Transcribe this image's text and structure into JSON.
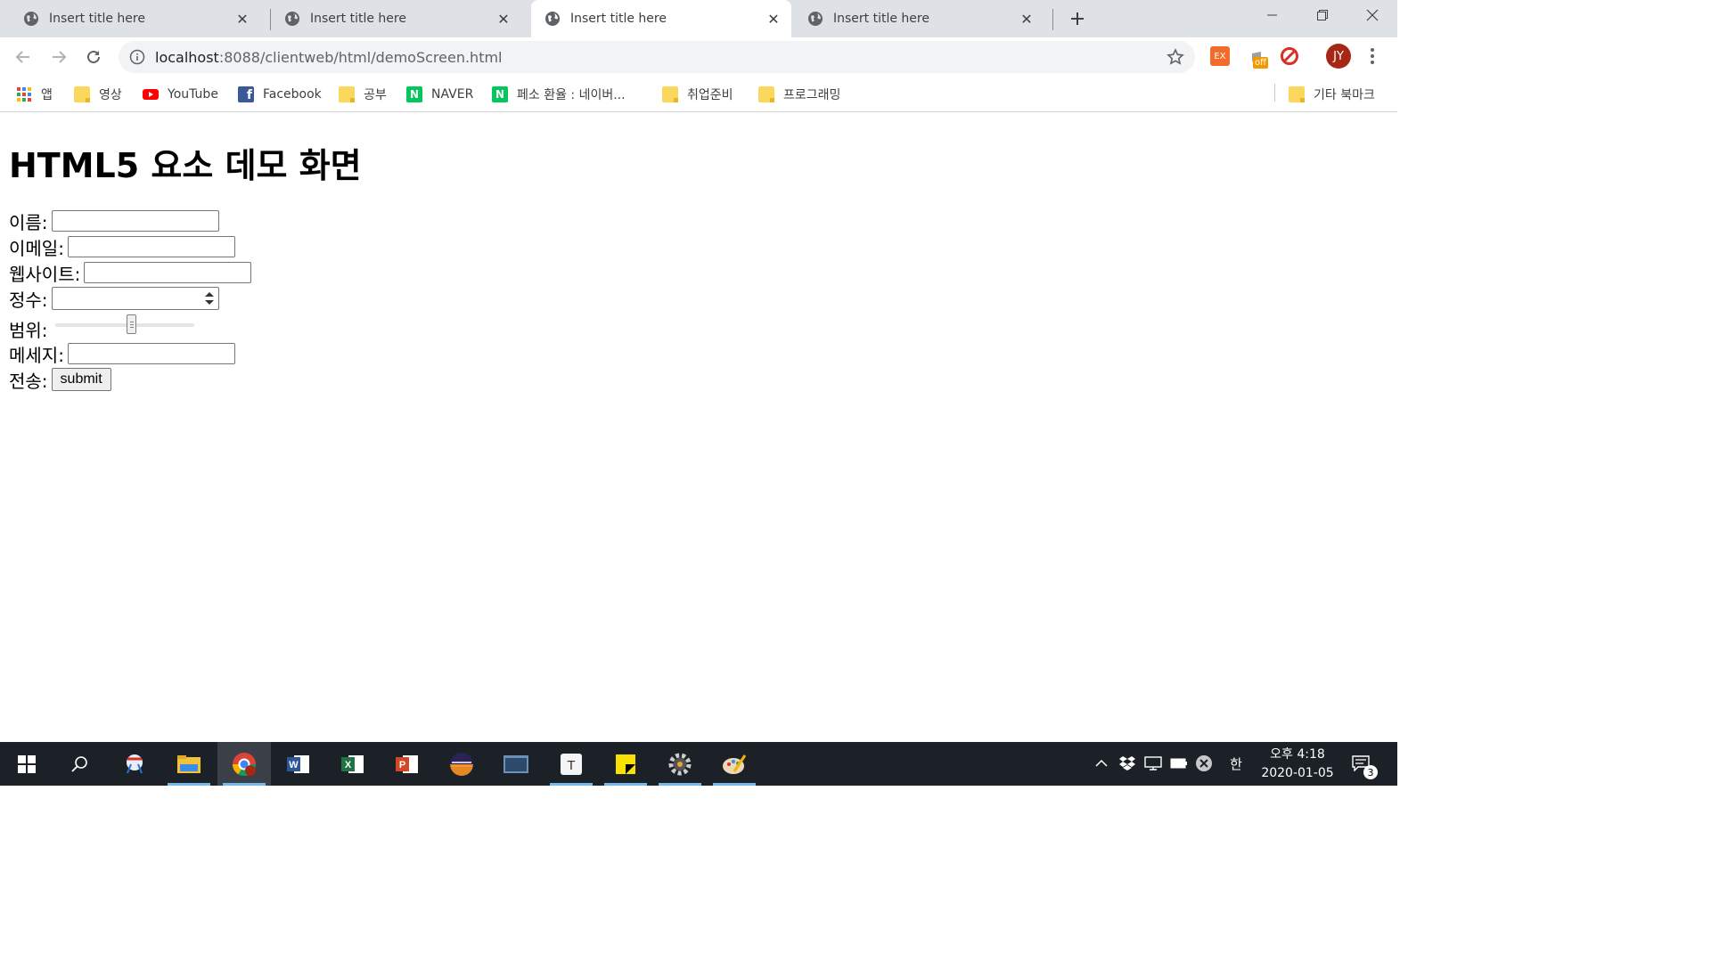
{
  "tabs": [
    {
      "title": "Insert title here",
      "active": false
    },
    {
      "title": "Insert title here",
      "active": false
    },
    {
      "title": "Insert title here",
      "active": true
    },
    {
      "title": "Insert title here",
      "active": false
    }
  ],
  "omnibox": {
    "host": "localhost",
    "path": ":8088/clientweb/html/demoScreen.html"
  },
  "profile": {
    "initials": "JY"
  },
  "extensions": {
    "ex_label": "EX",
    "off_badge": "off"
  },
  "bookmarks": [
    {
      "label": "앱",
      "icon": "apps-grid-icon"
    },
    {
      "label": "영상",
      "icon": "folder-icon"
    },
    {
      "label": "YouTube",
      "icon": "youtube-icon"
    },
    {
      "label": "Facebook",
      "icon": "facebook-icon"
    },
    {
      "label": "공부",
      "icon": "folder-icon"
    },
    {
      "label": "NAVER",
      "icon": "naver-icon"
    },
    {
      "label": "페소 환율 : 네이버...",
      "icon": "naver-icon"
    },
    {
      "label": "취업준비",
      "icon": "folder-icon"
    },
    {
      "label": "프로그래밍",
      "icon": "folder-icon"
    }
  ],
  "other_bookmarks": "기타 북마크",
  "page": {
    "heading": "HTML5 요소 데모 화면",
    "labels": {
      "name": "이름:",
      "email": "이메일:",
      "website": "웹사이트:",
      "integer": "정수:",
      "range": "범위:",
      "message": "메세지:",
      "submit": "전송:"
    },
    "fields": {
      "name": "",
      "email": "",
      "website": "",
      "integer": "",
      "message": ""
    },
    "range_value_fraction": 0.55,
    "submit_button": "submit"
  },
  "taskbar": {
    "apps": [
      "snipping-tool-icon",
      "file-explorer-icon",
      "chrome-icon",
      "word-icon",
      "excel-icon",
      "powerpoint-icon",
      "eclipse-icon",
      "sql-developer-icon",
      "typora-icon",
      "sticky-notes-icon",
      "settings-gear-icon",
      "paint-icon"
    ],
    "ime": "한",
    "time": "오후 4:18",
    "date": "2020-01-05",
    "notifications": "3"
  },
  "colors": {
    "tabstrip_bg": "#dee1e6",
    "omnibox_bg": "#f1f3f4",
    "avatar_bg": "#a52714",
    "taskbar_bg": "#1c2128",
    "taskbar_active_underline": "#76b9ed"
  }
}
